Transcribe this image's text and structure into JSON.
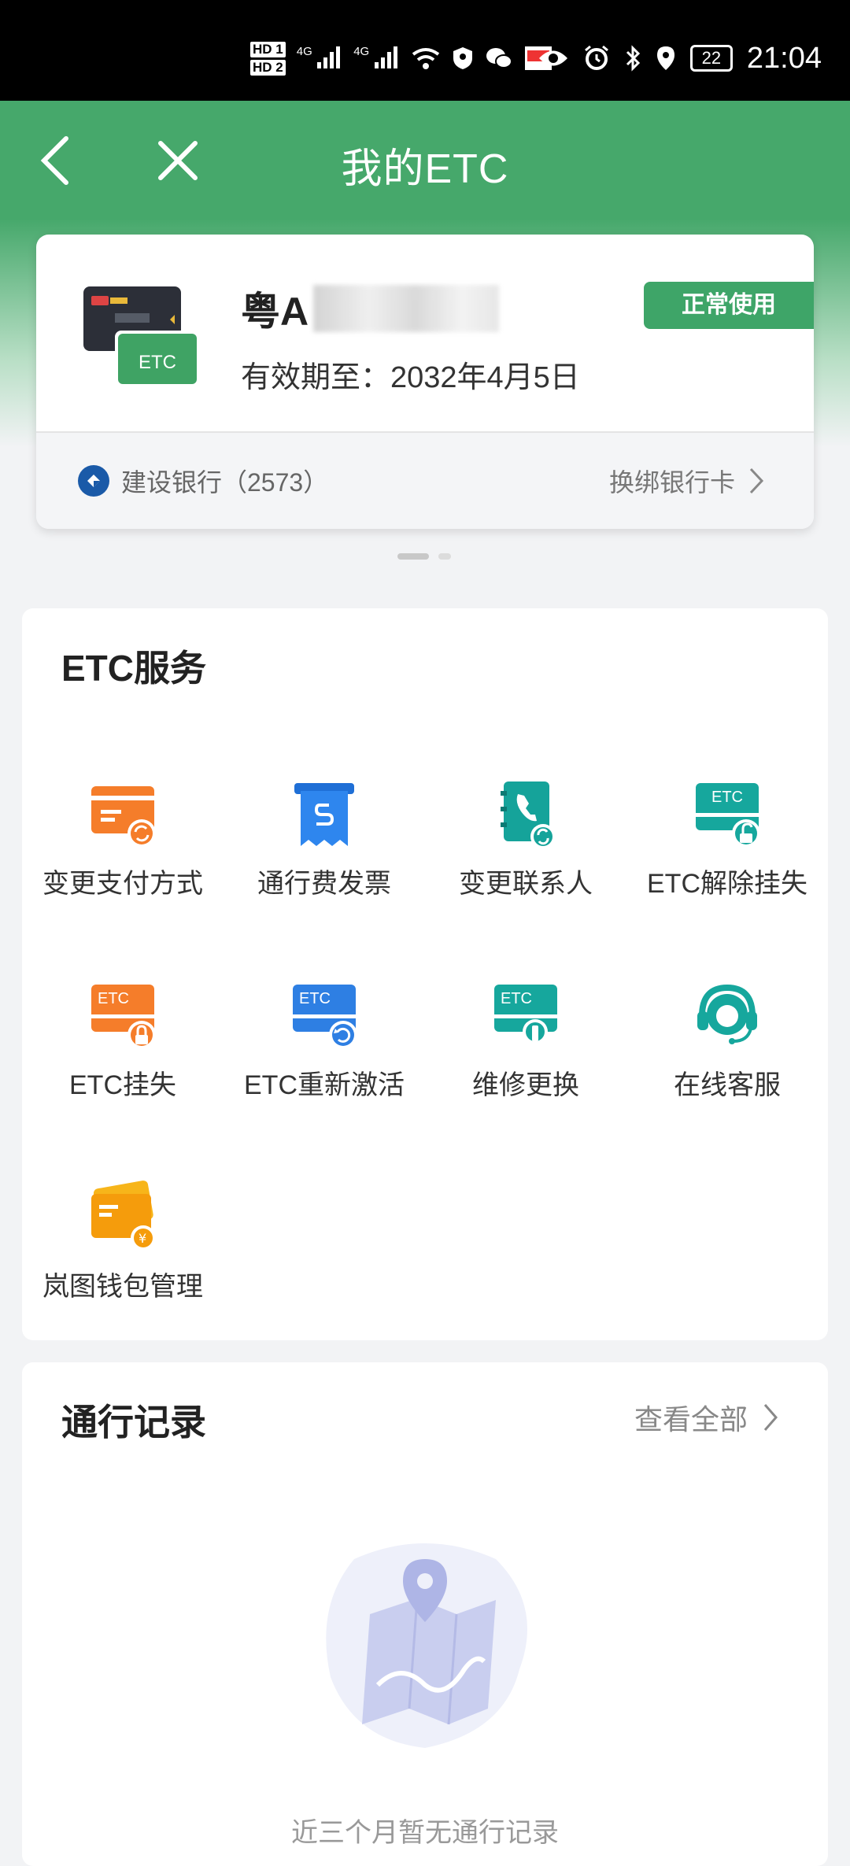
{
  "status_bar": {
    "sim1": "HD 1",
    "sim2": "HD 2",
    "net1": "4G",
    "net2": "4G",
    "battery": "22",
    "time": "21:04"
  },
  "nav": {
    "title": "我的ETC"
  },
  "card": {
    "plate_prefix": "粤A",
    "validity": "有效期至：2032年4月5日",
    "status": "正常使用",
    "icon_text": "ETC",
    "bank": "建设银行（2573）",
    "rebind": "换绑银行卡"
  },
  "services": {
    "title": "ETC服务",
    "items": [
      {
        "label": "变更支付方式",
        "icon": "payment-change-icon"
      },
      {
        "label": "通行费发票",
        "icon": "invoice-icon"
      },
      {
        "label": "变更联系人",
        "icon": "contact-change-icon"
      },
      {
        "label": "ETC解除挂失",
        "icon": "etc-unlock-icon"
      },
      {
        "label": "ETC挂失",
        "icon": "etc-lock-icon"
      },
      {
        "label": "ETC重新激活",
        "icon": "etc-reactivate-icon"
      },
      {
        "label": "维修更换",
        "icon": "repair-icon"
      },
      {
        "label": "在线客服",
        "icon": "headset-icon"
      },
      {
        "label": "岚图钱包管理",
        "icon": "wallet-icon"
      }
    ]
  },
  "records": {
    "title": "通行记录",
    "view_all": "查看全部",
    "empty": "近三个月暂无通行记录"
  }
}
